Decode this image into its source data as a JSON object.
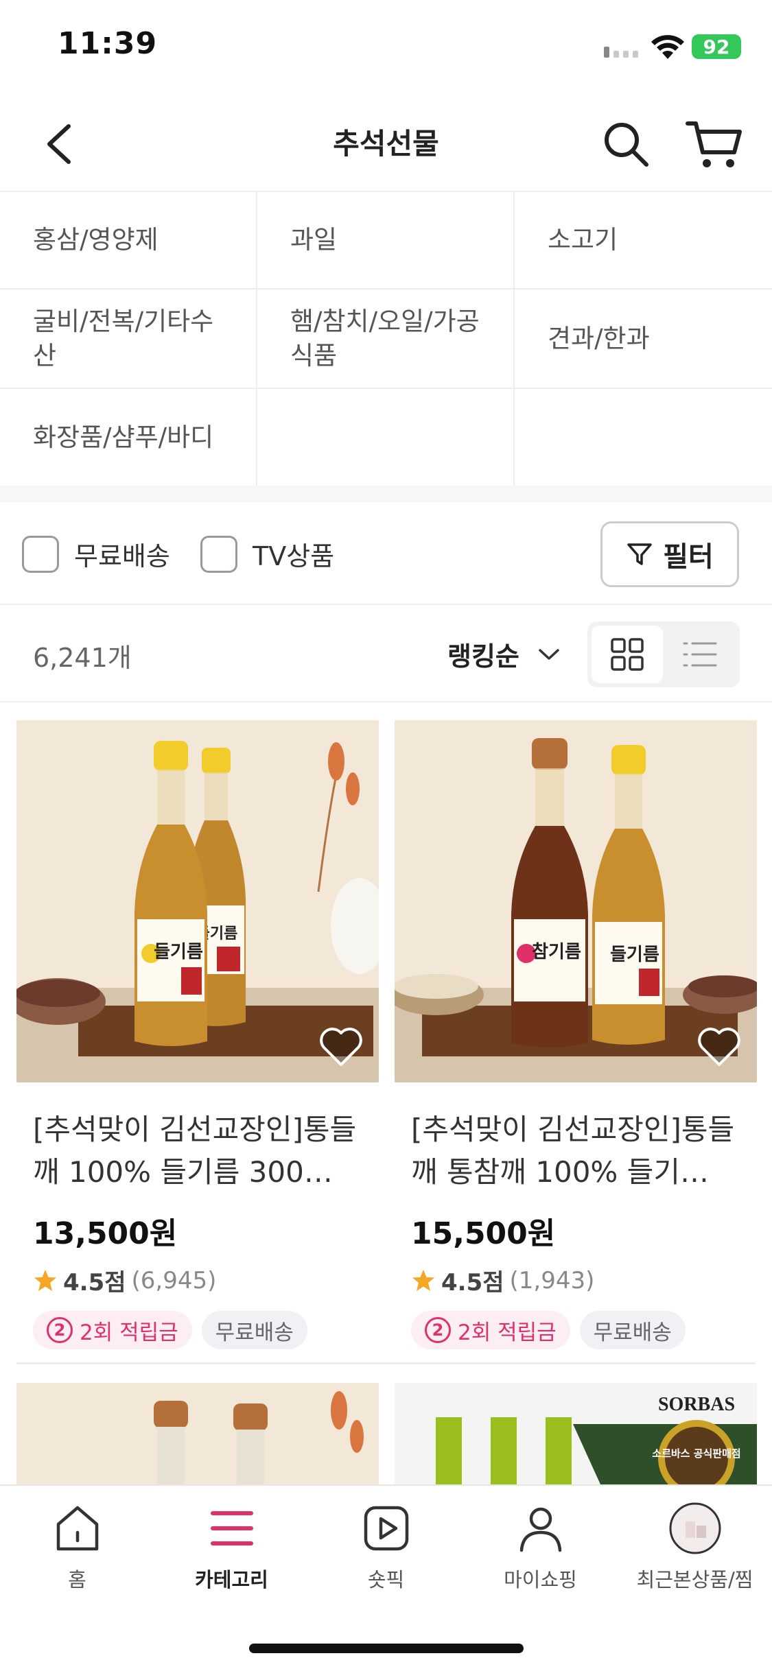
{
  "status_bar": {
    "time": "11:39",
    "battery": "92"
  },
  "header": {
    "title": "추석선물"
  },
  "categories": [
    "홍삼/영양제",
    "과일",
    "소고기",
    "굴비/전복/기타수산",
    "햄/참치/오일/가공식품",
    "견과/한과",
    "화장품/샴푸/바디",
    "",
    ""
  ],
  "filters": {
    "free_shipping": "무료배송",
    "tv_products": "TV상품",
    "filter_button": "필터"
  },
  "sort": {
    "count": "6,241개",
    "order": "랭킹순"
  },
  "products": [
    {
      "name": "[추석맞이 김선교장인]통들깨 100% 들기름 300…",
      "price": "13,500원",
      "rating": "4.5점",
      "reviews": "(6,945)",
      "points_badge": "2",
      "points_label": "2회 적립금",
      "shipping": "무료배송",
      "image": {
        "bottle_labels": [
          "들기름",
          "들기름"
        ]
      }
    },
    {
      "name": "[추석맞이 김선교장인]통들깨 통참깨 100% 들기…",
      "price": "15,500원",
      "rating": "4.5점",
      "reviews": "(1,943)",
      "points_badge": "2",
      "points_label": "2회 적립금",
      "shipping": "무료배송",
      "image": {
        "bottle_labels": [
          "참기름",
          "들기름"
        ]
      }
    }
  ],
  "partial_products": [
    {
      "image_text": ""
    },
    {
      "image_text": "SORBAS",
      "seal_text": "소르바스 공식판매점"
    }
  ],
  "bottom_nav": [
    {
      "label": "홈",
      "icon": "home-icon"
    },
    {
      "label": "카테고리",
      "icon": "menu-icon"
    },
    {
      "label": "숏픽",
      "icon": "play-icon"
    },
    {
      "label": "마이쇼핑",
      "icon": "person-icon"
    },
    {
      "label": "최근본상품/찜",
      "icon": "recent-icon"
    }
  ],
  "colors": {
    "accent": "#e0306a",
    "star": "#f5a623"
  }
}
